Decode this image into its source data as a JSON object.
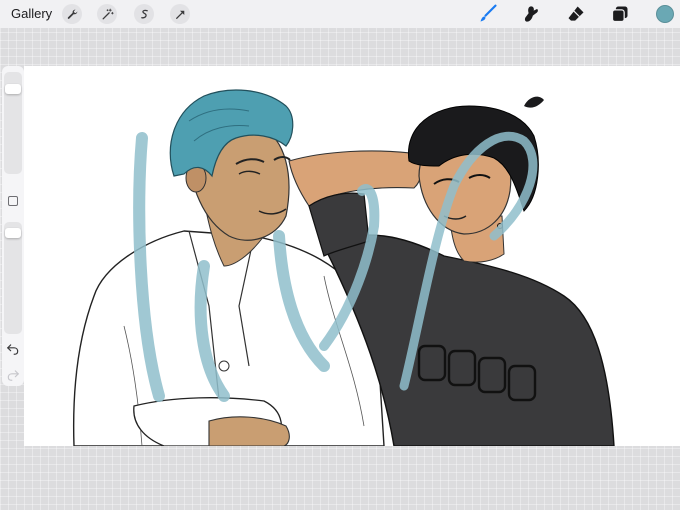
{
  "app": {
    "gallery_label": "Gallery"
  },
  "toolbar_left": [
    {
      "name": "wrench-icon"
    },
    {
      "name": "magic-wand-icon"
    },
    {
      "name": "selection-icon"
    },
    {
      "name": "transform-arrow-icon"
    }
  ],
  "toolbar_right": [
    {
      "name": "brush-icon",
      "active": true
    },
    {
      "name": "smudge-icon"
    },
    {
      "name": "eraser-icon"
    },
    {
      "name": "layers-icon"
    }
  ],
  "colors": {
    "accent": "#1a7bf2",
    "current_color": "#6aa8b4",
    "toolbar_bg": "#f1f1f3",
    "canvas_bg": "#ffffff",
    "stroke_color": "#8fbecb"
  },
  "sidebar": {
    "brush_size_label": "",
    "opacity_label": ""
  }
}
